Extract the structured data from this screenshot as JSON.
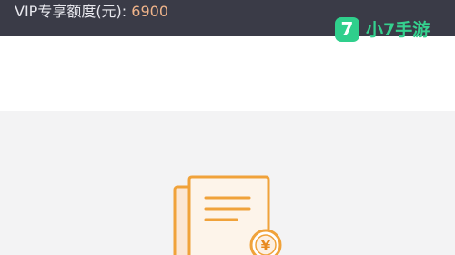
{
  "header": {
    "vip_label": "VIP专享额度(元): ",
    "vip_amount": "6900"
  },
  "watermark": {
    "badge": "7",
    "text": "小7手游"
  },
  "colors": {
    "topbar": "#3a3b47",
    "amount": "#f0b48a",
    "content_bg": "#f3f3f4",
    "illustration_orange": "#f0a23a",
    "watermark_green": "#2fcf8c"
  },
  "icons": {
    "empty_state": "document-yen-icon"
  }
}
